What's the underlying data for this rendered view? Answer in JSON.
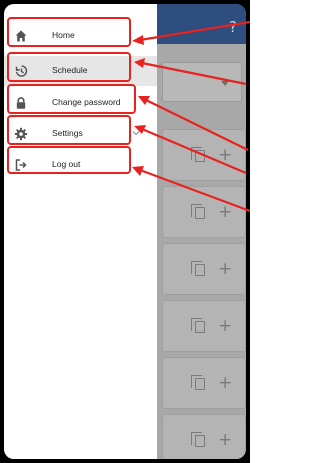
{
  "header": {
    "help_icon": "help-icon",
    "help_glyph": "?",
    "color": "#2f4e80"
  },
  "menu": {
    "items": [
      {
        "label": "Home",
        "icon": "home-icon"
      },
      {
        "label": "Schedule",
        "icon": "history-icon",
        "active": true
      },
      {
        "label": "Change password",
        "icon": "lock-icon"
      },
      {
        "label": "Settings",
        "icon": "gear-icon",
        "expandable": true
      },
      {
        "label": "Log out",
        "icon": "logout-icon"
      }
    ]
  },
  "cards": {
    "plus_glyph": "+"
  },
  "annotation": {
    "color": "#e8221f"
  }
}
